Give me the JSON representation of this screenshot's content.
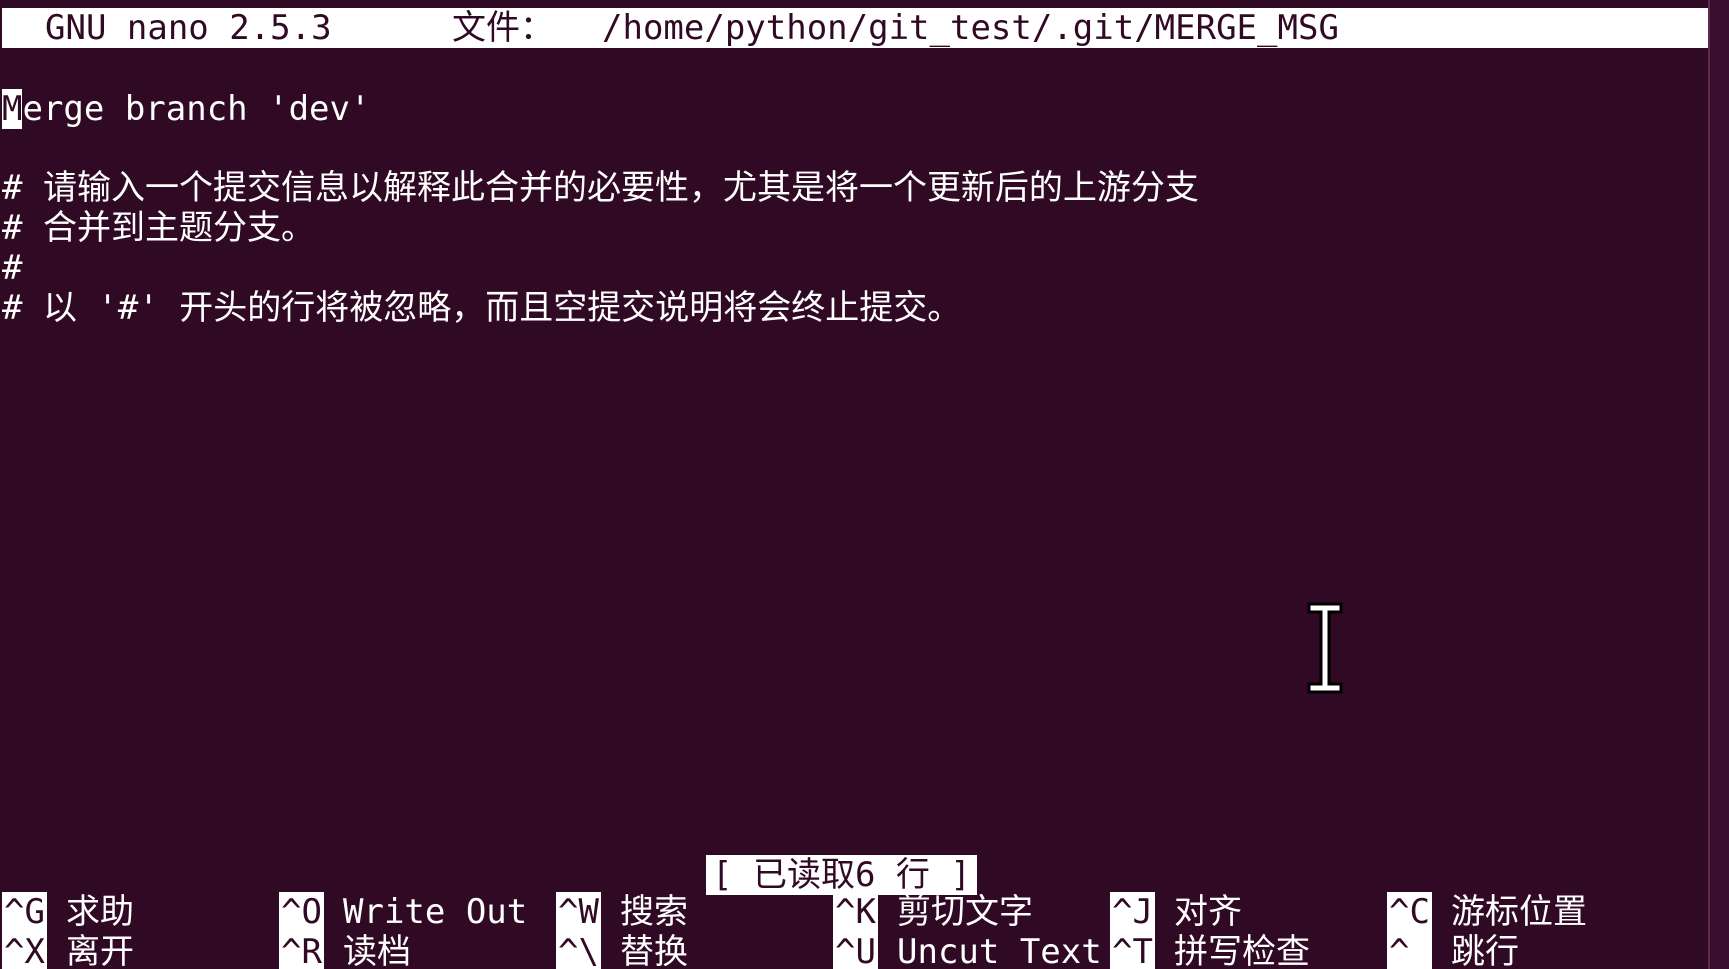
{
  "title_bar": {
    "app": "GNU nano 2.5.3",
    "file_label": "文件：",
    "file_path": "/home/python/git_test/.git/MERGE_MSG"
  },
  "editor": {
    "cursor_char": "M",
    "line1_rest": "erge branch 'dev'",
    "line3": "# 请输入一个提交信息以解释此合并的必要性，尤其是将一个更新后的上游分支",
    "line4": "# 合并到主题分支。",
    "line5": "#",
    "line6": "# 以 '#' 开头的行将被忽略，而且空提交说明将会终止提交。"
  },
  "status": "[ 已读取6 行 ]",
  "shortcuts": {
    "row1": [
      {
        "key": "^G",
        "label": "求助"
      },
      {
        "key": "^O",
        "label": "Write Out"
      },
      {
        "key": "^W",
        "label": "搜索"
      },
      {
        "key": "^K",
        "label": "剪切文字"
      },
      {
        "key": "^J",
        "label": "对齐"
      },
      {
        "key": "^C",
        "label": "游标位置"
      }
    ],
    "row2": [
      {
        "key": "^X",
        "label": "离开"
      },
      {
        "key": "^R",
        "label": "读档"
      },
      {
        "key": "^\\",
        "label": "替换"
      },
      {
        "key": "^U",
        "label": "Uncut Text"
      },
      {
        "key": "^T",
        "label": "拼写检查"
      },
      {
        "key": "^_",
        "label": "跳行"
      }
    ]
  },
  "colors": {
    "background": "#300a24",
    "foreground": "#ffffff"
  },
  "icons": {
    "mouse_pointer": "text-cursor-ibeam-icon"
  }
}
